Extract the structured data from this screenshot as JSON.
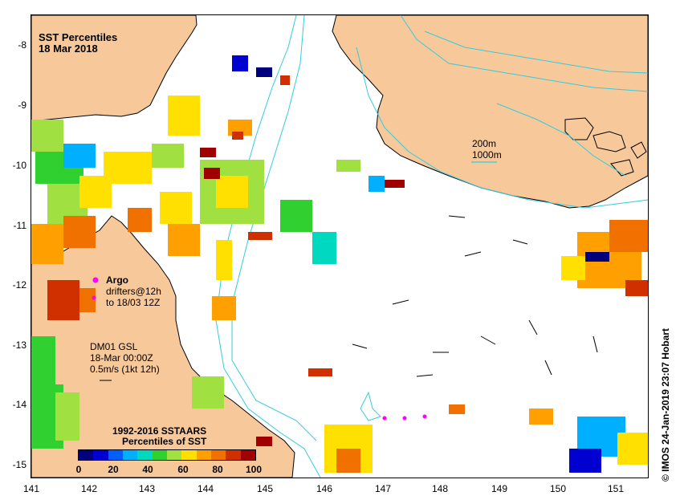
{
  "title": {
    "line1": "SST Percentiles",
    "line2": "18 Mar 2018"
  },
  "y_axis_labels": [
    "-8",
    "-9",
    "-10",
    "-11",
    "-12",
    "-13",
    "-14",
    "-15"
  ],
  "x_axis_labels": [
    "141",
    "142",
    "143",
    "144",
    "145",
    "146",
    "147",
    "148",
    "149",
    "150",
    "151"
  ],
  "bathymetry_legend": {
    "line1": "200m",
    "line2": "1000m"
  },
  "argo_legend": {
    "title": "Argo",
    "line1": "drifters@12h",
    "line2": "to 18/03 12Z"
  },
  "current_legend": {
    "line1": "DM01 GSL",
    "line2": "18-Mar 00:00Z",
    "line3": "0.5m/s (1kt 12h)"
  },
  "colorbar": {
    "title1": "1992-2016 SSTAARS",
    "title2": "Percentiles of SST",
    "ticks": [
      "0",
      "20",
      "40",
      "60",
      "80",
      "100"
    ],
    "colors": [
      "#00007f",
      "#0000d0",
      "#0060ff",
      "#00b0ff",
      "#00d8c0",
      "#30d030",
      "#a0e040",
      "#ffe000",
      "#ffa000",
      "#f07000",
      "#d03000",
      "#a00000"
    ]
  },
  "credit": "© IMOS 24-Jan-2019 23:07 Hobart",
  "colors": {
    "land": "#f7c89a",
    "contour": "#33ccdd",
    "argo": "#ff00ff"
  }
}
